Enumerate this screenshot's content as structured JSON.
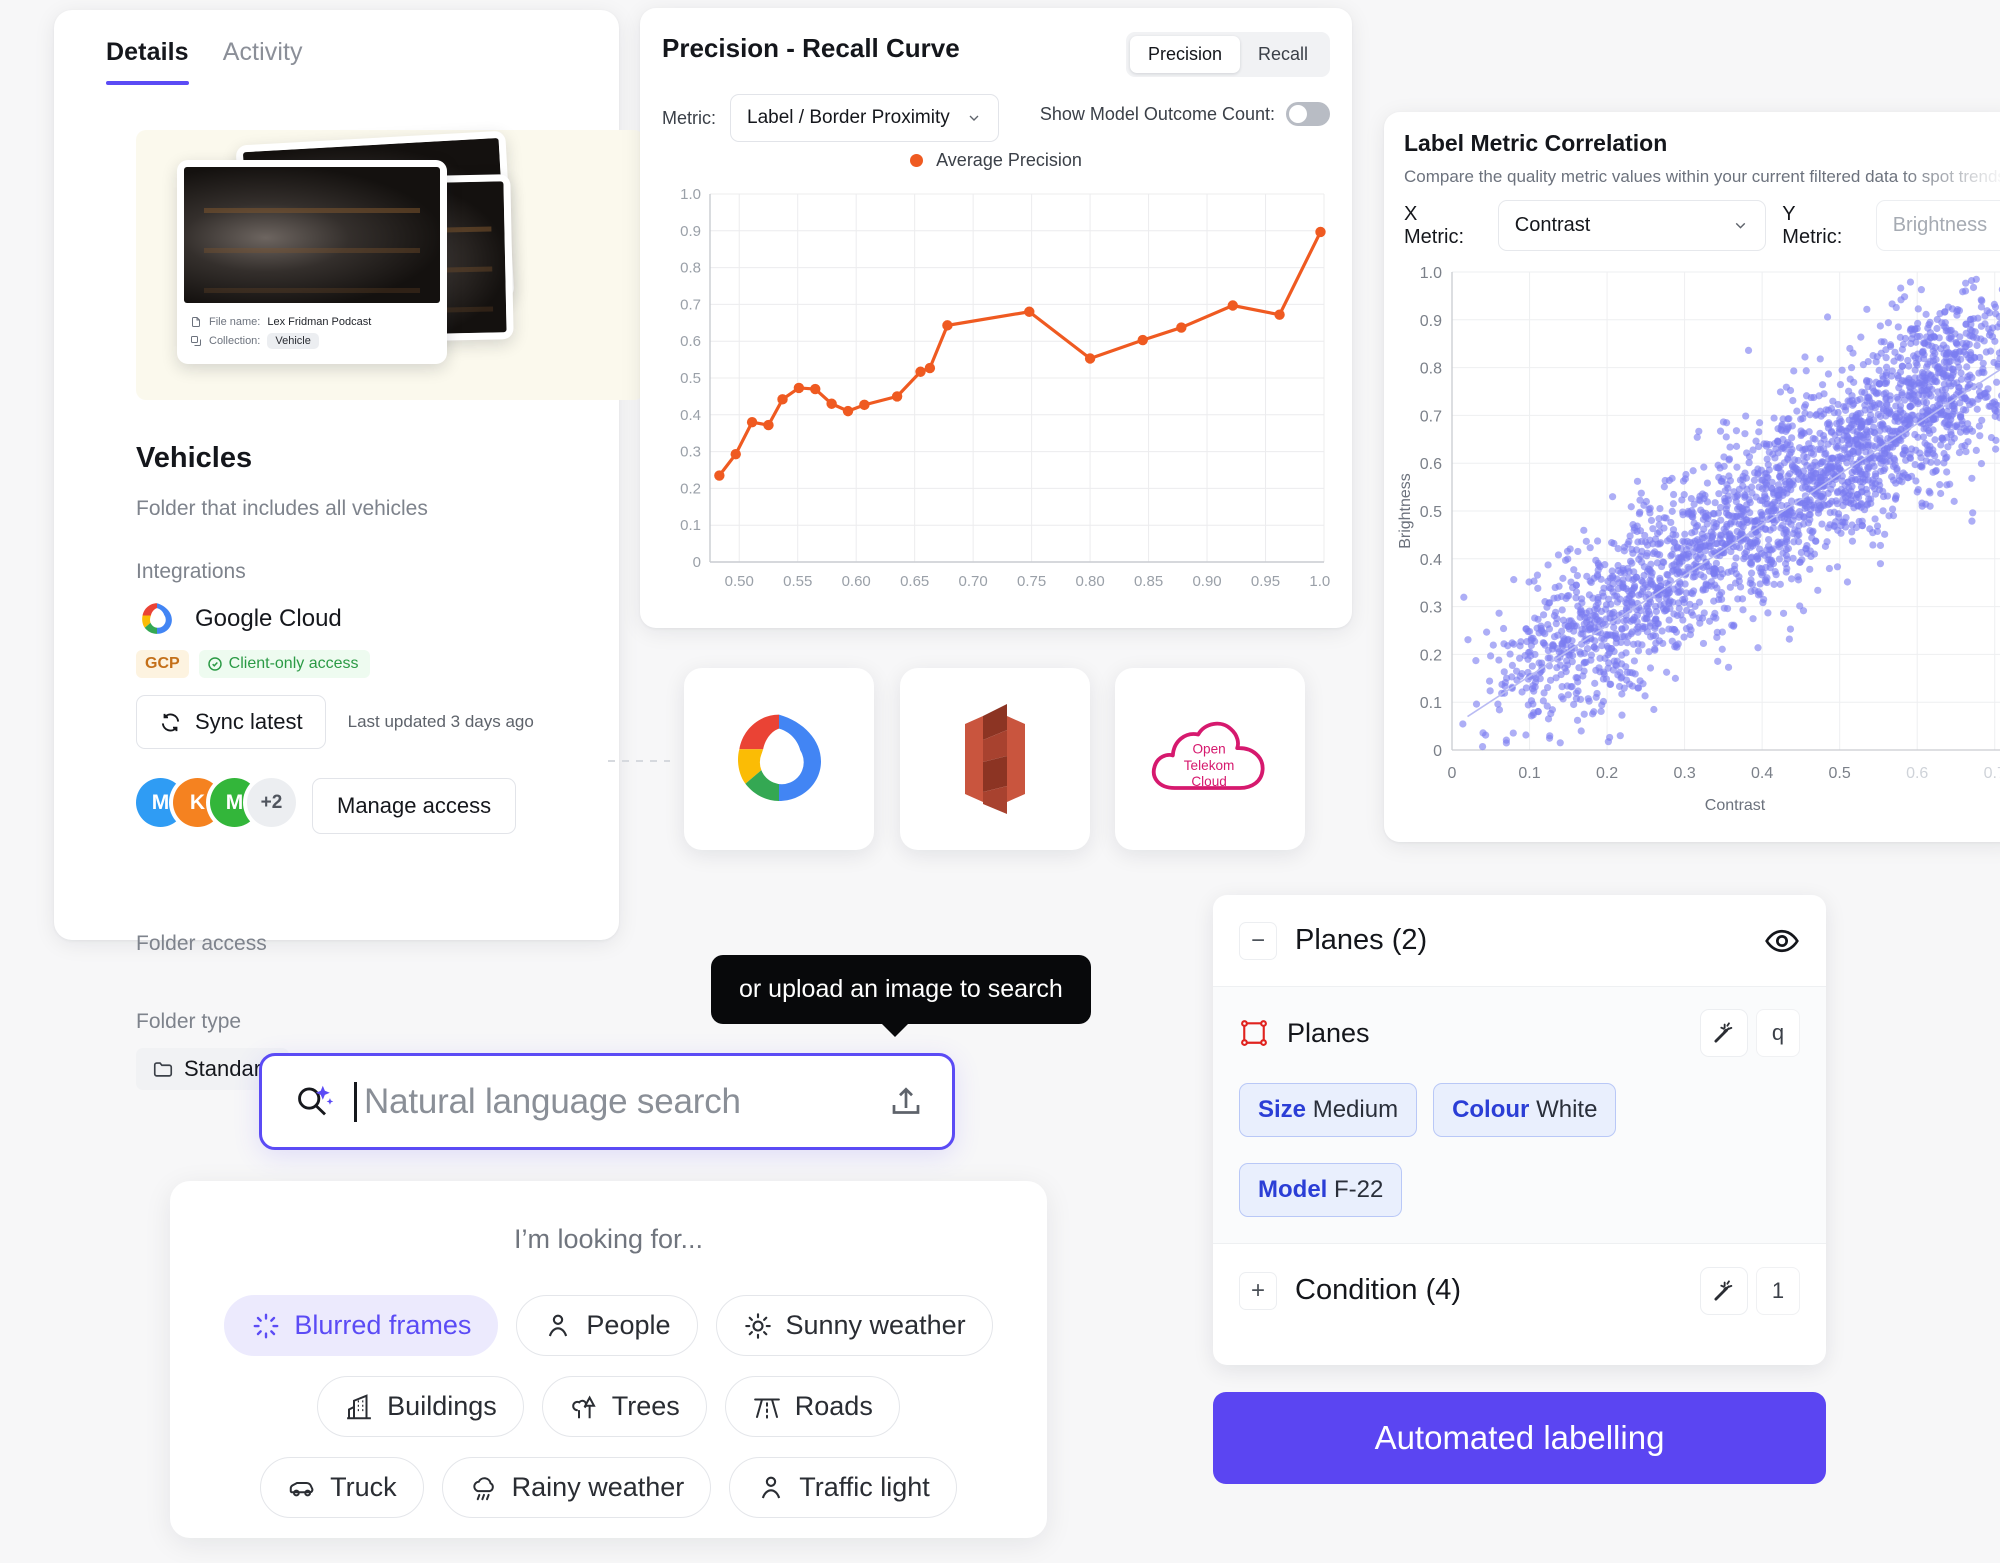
{
  "details": {
    "tabs": [
      {
        "label": "Details",
        "active": true
      },
      {
        "label": "Activity",
        "active": false
      }
    ],
    "thumbnail": {
      "file_name_label": "File name:",
      "file_name_value": "Lex Fridman Podcast",
      "collection_label": "Collection:",
      "collection_value": "Vehicle"
    },
    "title": "Vehicles",
    "subtitle": "Folder that includes all vehicles",
    "integrations_label": "Integrations",
    "integration_name": "Google Cloud",
    "badge_provider": "GCP",
    "badge_access": "Client-only access",
    "sync_button": "Sync latest",
    "sync_note": "Last updated 3 days ago",
    "folder_access_label": "Folder access",
    "avatars": [
      "M",
      "K",
      "M"
    ],
    "avatar_overflow": "+2",
    "manage_access_button": "Manage access",
    "folder_type_label": "Folder type",
    "folder_type_value": "Standard"
  },
  "pr": {
    "title": "Precision - Recall Curve",
    "segments": [
      {
        "label": "Precision",
        "active": true
      },
      {
        "label": "Recall",
        "active": false
      }
    ],
    "metric_label": "Metric:",
    "metric_value": "Label / Border Proximity",
    "toggle_label": "Show Model Outcome Count:",
    "toggle_on": false,
    "legend_label": "Average Precision"
  },
  "integration_logos": [
    {
      "name": "google-cloud-logo"
    },
    {
      "name": "aws-s3-logo"
    },
    {
      "name": "open-telekom-cloud-logo",
      "text": [
        "Open",
        "Telekom",
        "Cloud"
      ]
    }
  ],
  "lmc": {
    "title": "Label Metric Correlation",
    "subtitle": "Compare the quality metric values within your current filtered data to spot trends or correlations",
    "x_metric_label": "X Metric:",
    "x_metric_value": "Contrast",
    "y_metric_label": "Y Metric:",
    "y_metric_placeholder": "Brightness"
  },
  "search": {
    "tooltip": "or upload an image to search",
    "placeholder": "Natural language search",
    "upload_icon": "upload-icon",
    "search_icon": "sparkle-search-icon"
  },
  "suggestions": {
    "heading": "I’m looking for...",
    "chips": [
      {
        "label": "Blurred frames",
        "icon": "blur-icon",
        "selected": true
      },
      {
        "label": "People",
        "icon": "person-icon",
        "selected": false
      },
      {
        "label": "Sunny weather",
        "icon": "sun-icon",
        "selected": false
      },
      {
        "label": "Buildings",
        "icon": "building-icon",
        "selected": false
      },
      {
        "label": "Trees",
        "icon": "tree-icon",
        "selected": false
      },
      {
        "label": "Roads",
        "icon": "road-icon",
        "selected": false
      },
      {
        "label": "Truck",
        "icon": "truck-icon",
        "selected": false
      },
      {
        "label": "Rainy weather",
        "icon": "rain-icon",
        "selected": false
      },
      {
        "label": "Traffic light",
        "icon": "person-icon",
        "selected": false
      }
    ]
  },
  "labels": {
    "group_title": "Planes (2)",
    "group_collapse_glyph": "−",
    "eye_icon": "eye-icon",
    "object_title": "Planes",
    "object_shortcut": "q",
    "magic_icon": "magic-wand-icon",
    "attributes": [
      {
        "key": "Size",
        "value": "Medium"
      },
      {
        "key": "Colour",
        "value": "White"
      },
      {
        "key": "Model",
        "value": "F-22"
      }
    ],
    "condition_title": "Condition (4)",
    "condition_expand_glyph": "+",
    "condition_shortcut": "1",
    "automated_button": "Automated labelling"
  },
  "colors": {
    "accent": "#5b45f2",
    "pr_line": "#ef5a21",
    "scatter": "#7b7df0",
    "tab_underline": "#5b4bf5",
    "badge_green": "#2b9a45",
    "badge_orange": "#c4701a"
  },
  "chart_data": [
    {
      "type": "line",
      "title": "Precision - Recall Curve",
      "xlabel": "",
      "ylabel": "",
      "xlim": [
        0.475,
        1.0
      ],
      "ylim": [
        0,
        1.0
      ],
      "xticks": [
        0.5,
        0.55,
        0.6,
        0.65,
        0.7,
        0.75,
        0.8,
        0.85,
        0.9,
        0.95,
        1.0
      ],
      "yticks": [
        0,
        0.1,
        0.2,
        0.3,
        0.4,
        0.5,
        0.6,
        0.7,
        0.8,
        0.9,
        1.0
      ],
      "grid": true,
      "legend": [
        "Average Precision"
      ],
      "legend_position": "top-center",
      "series": [
        {
          "name": "Average Precision",
          "color": "#ef5a21",
          "x": [
            0.483,
            0.497,
            0.511,
            0.525,
            0.537,
            0.551,
            0.565,
            0.579,
            0.593,
            0.607,
            0.635,
            0.655,
            0.663,
            0.678,
            0.748,
            0.8,
            0.845,
            0.878,
            0.922,
            0.962,
            0.997
          ],
          "y": [
            0.235,
            0.293,
            0.38,
            0.372,
            0.442,
            0.473,
            0.47,
            0.43,
            0.41,
            0.427,
            0.45,
            0.517,
            0.527,
            0.643,
            0.68,
            0.553,
            0.603,
            0.637,
            0.697,
            0.672,
            0.897
          ]
        }
      ]
    },
    {
      "type": "scatter",
      "title": "Label Metric Correlation",
      "xlabel": "Contrast",
      "ylabel": "Brightness",
      "xlim": [
        0,
        0.73
      ],
      "ylim": [
        0,
        1.0
      ],
      "xticks": [
        0,
        0.1,
        0.2,
        0.3,
        0.4,
        0.5,
        0.6,
        0.7
      ],
      "yticks": [
        0,
        0.1,
        0.2,
        0.3,
        0.4,
        0.5,
        0.6,
        0.7,
        0.8,
        0.9,
        1.0
      ],
      "grid": true,
      "point_color": "#7b7df0",
      "n_points": 2600,
      "trend_line": true,
      "description": "Dense positively-correlated cloud of points rising from lower-left to upper-right with a faint straight trend line."
    }
  ]
}
